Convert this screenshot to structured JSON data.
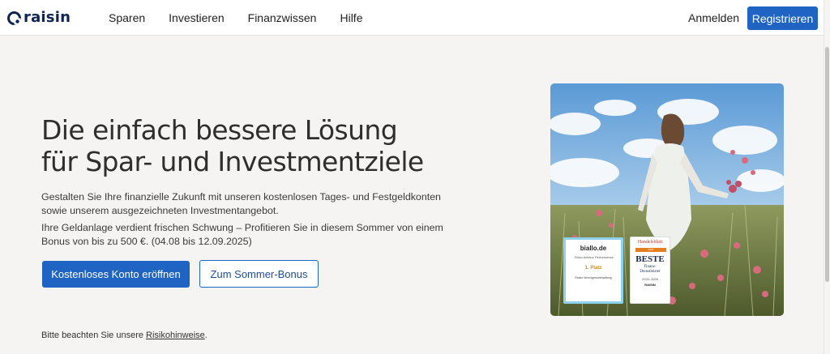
{
  "header": {
    "logo_text": "raisin",
    "nav": [
      "Sparen",
      "Investieren",
      "Finanzwissen",
      "Hilfe"
    ],
    "login_label": "Anmelden",
    "register_label": "Registrieren"
  },
  "hero": {
    "title_line1": "Die einfach bessere Lösung",
    "title_line2": "für Spar- und Investmentziele",
    "paragraph1": "Gestalten Sie Ihre finanzielle Zukunft mit unseren kostenlosen Tages- und Festgeldkonten sowie unserem ausgezeichneten Investmentangebot.",
    "paragraph2": "Ihre Geldanlage verdient frischen Schwung – Profitieren Sie in diesem Sommer von einem Bonus von bis zu 500 €. (04.08 bis 12.09.2025)",
    "primary_button": "Kostenloses Konto eröffnen",
    "secondary_button": "Zum Sommer-Bonus",
    "note_prefix": "Bitte beachten Sie unsere ",
    "note_link": "Risikohinweise",
    "note_suffix": "."
  },
  "badges": {
    "biallo": {
      "logo": "biallo.de",
      "subtitle": "Robo Advisor Performance",
      "place": "1. Platz",
      "detail": "Raisin Vermögensverwaltung"
    },
    "handelsblatt": {
      "logo": "Handelsblatt",
      "top": "2025",
      "beste": "BESTE",
      "category_line1": "Finanz-",
      "category_line2": "Dienstleister",
      "years": "2025–2026",
      "brand": "RAISIN"
    }
  },
  "colors": {
    "brand_navy": "#0f2550",
    "primary_blue": "#1f63c3",
    "background": "#f5f4f2"
  },
  "icons": [
    "raisin-logo-icon"
  ]
}
